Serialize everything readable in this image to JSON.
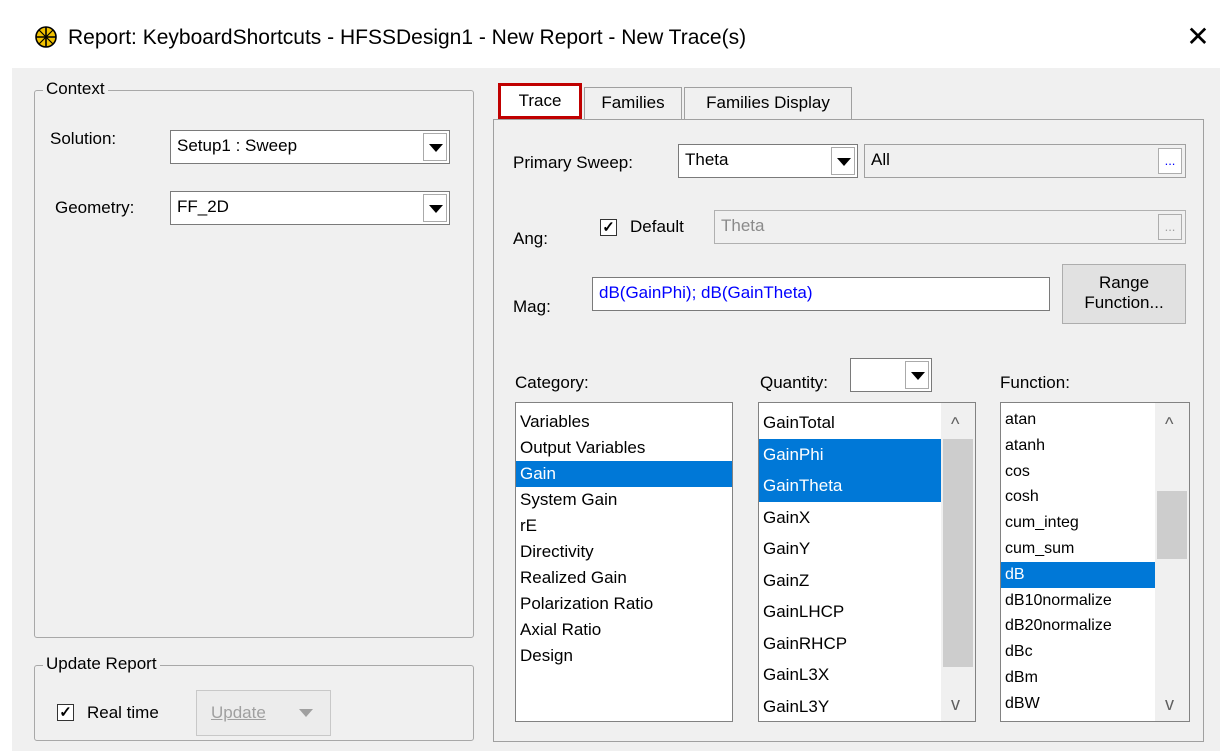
{
  "window": {
    "title": "Report: KeyboardShortcuts - HFSSDesign1 - New Report - New Trace(s)",
    "close": "✕"
  },
  "context": {
    "legend": "Context",
    "solution_label": "Solution:",
    "solution_value": "Setup1 : Sweep",
    "geometry_label": "Geometry:",
    "geometry_value": "FF_2D"
  },
  "update_report": {
    "legend": "Update Report",
    "realtime_label": "Real time",
    "realtime_checked": true,
    "update_button": "Update"
  },
  "tabs": [
    {
      "label": "Trace",
      "active": true
    },
    {
      "label": "Families",
      "active": false
    },
    {
      "label": "Families Display",
      "active": false
    }
  ],
  "trace": {
    "primary_sweep_label": "Primary Sweep:",
    "primary_sweep_value": "Theta",
    "primary_sweep_range": "All",
    "ellipsis": "...",
    "ang_label": "Ang:",
    "default_label": "Default",
    "default_checked": true,
    "ang_value": "Theta",
    "mag_label": "Mag:",
    "mag_value": "dB(GainPhi); dB(GainTheta)",
    "range_button_line1": "Range",
    "range_button_line2": "Function...",
    "category_label": "Category:",
    "quantity_label": "Quantity:",
    "quantity_filter": "",
    "function_label": "Function:",
    "categories": [
      "Variables",
      "Output Variables",
      "Gain",
      "System Gain",
      "rE",
      "Directivity",
      "Realized Gain",
      "Polarization Ratio",
      "Axial Ratio",
      "Design"
    ],
    "categories_selected": "Gain",
    "quantities": [
      "GainTotal",
      "GainPhi",
      "GainTheta",
      "GainX",
      "GainY",
      "GainZ",
      "GainLHCP",
      "GainRHCP",
      "GainL3X",
      "GainL3Y"
    ],
    "quantities_selected": [
      "GainPhi",
      "GainTheta"
    ],
    "functions": [
      "atan",
      "atanh",
      "cos",
      "cosh",
      "cum_integ",
      "cum_sum",
      "dB",
      "dB10normalize",
      "dB20normalize",
      "dBc",
      "dBm",
      "dBW"
    ],
    "functions_selected": "dB"
  },
  "colors": {
    "selection": "#0078d7",
    "mag_text": "#0000ff",
    "tab_highlight": "#c00000"
  }
}
